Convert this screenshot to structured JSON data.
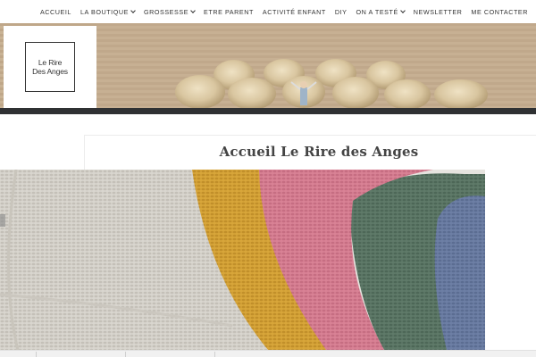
{
  "nav": {
    "items": [
      {
        "label": "Accueil",
        "dropdown": false
      },
      {
        "label": "La Boutique",
        "dropdown": true
      },
      {
        "label": "Grossesse",
        "dropdown": true
      },
      {
        "label": "Etre Parent",
        "dropdown": false
      },
      {
        "label": "Activité Enfant",
        "dropdown": false
      },
      {
        "label": "DIY",
        "dropdown": false
      },
      {
        "label": "On a testé",
        "dropdown": true
      },
      {
        "label": "Newsletter",
        "dropdown": false
      },
      {
        "label": "Me Contacter",
        "dropdown": false
      }
    ]
  },
  "logo": {
    "line1": "Le Rire",
    "line2": "Des Anges"
  },
  "page": {
    "title": "Accueil Le Rire des Anges"
  },
  "colors": {
    "header_bar": "#2f3133",
    "knit_grey": "#d9d6cf",
    "knit_mustard": "#d8a63a",
    "knit_pink": "#d98295",
    "knit_green": "#5f7a69",
    "knit_blue": "#6d7fa5"
  }
}
